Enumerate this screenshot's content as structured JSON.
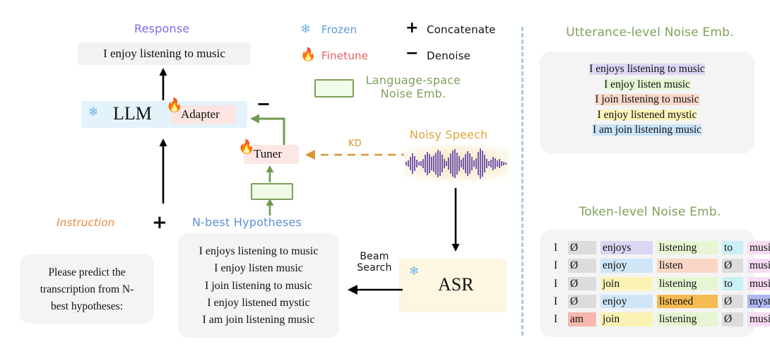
{
  "legend": {
    "frozen": {
      "label": "Frozen",
      "icon": "snowflake-icon",
      "color": "#5b9bd5"
    },
    "finetune": {
      "label": "Finetune",
      "icon": "flame-icon",
      "color": "#e8615e"
    },
    "concatenate": {
      "symbol": "+",
      "label": "Concatenate"
    },
    "denoise": {
      "symbol": "−",
      "label": "Denoise"
    },
    "noise_emb": {
      "line1": "Language-space",
      "line2": "Noise Emb.",
      "color": "#7fa05a"
    }
  },
  "left": {
    "response_label": "Response",
    "response_text": "I enjoy listening to music",
    "llm_label": "LLM",
    "adapter_label": "Adapter",
    "tuner_label": "Tuner",
    "denoise_symbol": "−",
    "concat_symbol": "+",
    "instruction_label": "Instruction",
    "instruction_text": "Please predict the transcription from N-best hypotheses:",
    "nbest_label": "N-best Hypotheses",
    "nbest_hypotheses": [
      "I enjoys listening to music",
      "I enjoy listen music",
      "I join listening to music",
      "I enjoy listened mystic",
      "I am join listening music"
    ],
    "kd_label": "KD",
    "noisy_speech_label": "Noisy Speech",
    "asr_label": "ASR",
    "beam_search_label_line1": "Beam",
    "beam_search_label_line2": "Search"
  },
  "right": {
    "utterance_panel": {
      "title": "Utterance-level Noise Emb.",
      "rows": [
        {
          "text": "I enjoys listening to music",
          "color": "#ded7f5"
        },
        {
          "text": "I enjoy listen music",
          "color": "#e4f5cf"
        },
        {
          "text": "I join listening to music",
          "color": "#fad8ca"
        },
        {
          "text": "I enjoy listened mystic",
          "color": "#fbf4b8"
        },
        {
          "text": "I am join listening music",
          "color": "#c9e4f7"
        }
      ]
    },
    "token_panel": {
      "title": "Token-level Noise Emb.",
      "rows": [
        [
          {
            "t": "I",
            "c": "transparent"
          },
          {
            "t": "Ø",
            "c": "#dcdcdc"
          },
          {
            "t": "enjoys",
            "c": "#ddd5f4"
          },
          {
            "t": "listening",
            "c": "#e7f6d2"
          },
          {
            "t": "to",
            "c": "#c9f0f5"
          },
          {
            "t": "music",
            "c": "#f7dcf3"
          }
        ],
        [
          {
            "t": "I",
            "c": "transparent"
          },
          {
            "t": "Ø",
            "c": "#dcdcdc"
          },
          {
            "t": "enjoy",
            "c": "#cfe6f9"
          },
          {
            "t": "listen",
            "c": "#fad7c5"
          },
          {
            "t": "Ø",
            "c": "#dcdcdc"
          },
          {
            "t": "music",
            "c": "#f7dcf3"
          }
        ],
        [
          {
            "t": "I",
            "c": "transparent"
          },
          {
            "t": "Ø",
            "c": "#dcdcdc"
          },
          {
            "t": "join",
            "c": "#fbf3b4"
          },
          {
            "t": "listening",
            "c": "#e7f6d2"
          },
          {
            "t": "to",
            "c": "#c9f0f5"
          },
          {
            "t": "music",
            "c": "#f7dcf3"
          }
        ],
        [
          {
            "t": "I",
            "c": "transparent"
          },
          {
            "t": "Ø",
            "c": "#dcdcdc"
          },
          {
            "t": "enjoy",
            "c": "#cfe6f9"
          },
          {
            "t": "listened",
            "c": "#f5bc53"
          },
          {
            "t": "Ø",
            "c": "#dcdcdc"
          },
          {
            "t": "mystic",
            "c": "#aeb8ee"
          }
        ],
        [
          {
            "t": "I",
            "c": "transparent"
          },
          {
            "t": "am",
            "c": "#f6b8ac"
          },
          {
            "t": "join",
            "c": "#fbf3b4"
          },
          {
            "t": "listening",
            "c": "#e7f6d2"
          },
          {
            "t": "Ø",
            "c": "#dcdcdc"
          },
          {
            "t": "music",
            "c": "#f7dcf3"
          }
        ]
      ]
    }
  }
}
